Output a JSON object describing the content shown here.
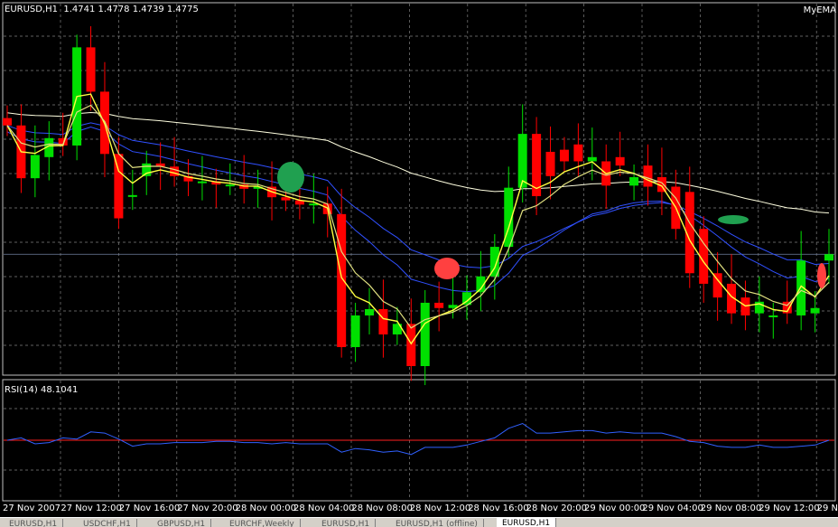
{
  "main_chart": {
    "symbol": "EURUSD,H1",
    "ohlc": "1.4741 1.4778 1.4739 1.4775",
    "indicator_name": "MyEMA",
    "time_labels": [
      "27 Nov 2007",
      "27 Nov 12:00",
      "27 Nov 16:00",
      "27 Nov 20:00",
      "28 Nov 00:00",
      "28 Nov 04:00",
      "28 Nov 08:00",
      "28 Nov 12:00",
      "28 Nov 16:00",
      "28 Nov 20:00",
      "29 Nov 00:00",
      "29 Nov 04:00",
      "29 Nov 08:00",
      "29 Nov 12:00",
      "29 Nov"
    ]
  },
  "sub_chart": {
    "indicator_label": "RSI(14) 48.1041"
  },
  "tabs": [
    {
      "label": "EURUSD,H1",
      "active": false
    },
    {
      "label": "USDCHF,H1",
      "active": false
    },
    {
      "label": "GBPUSD,H1",
      "active": false
    },
    {
      "label": "EURCHF,Weekly",
      "active": false
    },
    {
      "label": "EURUSD,H1",
      "active": false
    },
    {
      "label": "EURUSD,H1 (offline)",
      "active": false
    },
    {
      "label": "EURUSD,H1",
      "active": true
    }
  ],
  "colors": {
    "bull": "#00e000",
    "bear": "#ff0000",
    "ema_fast": "#ffff40",
    "ema_slow": "#e0e080",
    "ema_blue": "#3050ff",
    "ema_white": "#ffffe0",
    "rsi": "#3060ff",
    "rsi_level": "#ff2020",
    "grid": "#808080"
  },
  "chart_data": {
    "type": "candlestick",
    "open": [
      1.4655,
      1.4648,
      1.4598,
      1.4618,
      1.4636,
      1.4629,
      1.4722,
      1.468,
      1.4621,
      1.4582,
      1.46,
      1.4612,
      1.4609,
      1.46,
      1.4595,
      1.4595,
      1.4592,
      1.4592,
      1.4588,
      1.459,
      1.458,
      1.4577,
      1.4573,
      1.4574,
      1.4564,
      1.4438,
      1.4468,
      1.4474,
      1.445,
      1.446,
      1.442,
      1.448,
      1.4475,
      1.4478,
      1.449,
      1.4505,
      1.4533,
      1.4589,
      1.464,
      1.4623,
      1.4625,
      1.463,
      1.4614,
      1.4614,
      1.4618,
      1.4591,
      1.461,
      1.4599,
      1.459,
      1.4585,
      1.455,
      1.4508,
      1.4498,
      1.4485,
      1.447,
      1.4468,
      1.4481,
      1.4468,
      1.447,
      1.452
    ],
    "close": [
      1.4648,
      1.4598,
      1.462,
      1.4636,
      1.4629,
      1.4722,
      1.468,
      1.4621,
      1.456,
      1.4582,
      1.4612,
      1.4609,
      1.46,
      1.4595,
      1.4595,
      1.4592,
      1.4592,
      1.4588,
      1.459,
      1.458,
      1.4577,
      1.4573,
      1.4574,
      1.4564,
      1.4438,
      1.4468,
      1.4474,
      1.445,
      1.446,
      1.442,
      1.448,
      1.4475,
      1.4478,
      1.449,
      1.4505,
      1.4533,
      1.4589,
      1.464,
      1.4581,
      1.46,
      1.4614,
      1.4614,
      1.4618,
      1.4591,
      1.461,
      1.4599,
      1.459,
      1.4585,
      1.455,
      1.4508,
      1.4498,
      1.4485,
      1.447,
      1.4468,
      1.4481,
      1.4468,
      1.447,
      1.452,
      1.4475,
      1.4526
    ],
    "xlabel": "",
    "ylabel": ""
  },
  "rsi_data": [
    50,
    52,
    47,
    48,
    52,
    51,
    57,
    56,
    51,
    45,
    47,
    47,
    48,
    48,
    48,
    49,
    49,
    48,
    48,
    47,
    48,
    47,
    47,
    47,
    40,
    43,
    42,
    40,
    41,
    38,
    44,
    44,
    44,
    46,
    49,
    52,
    60,
    64,
    56,
    56,
    57,
    58,
    58,
    56,
    57,
    56,
    56,
    56,
    53,
    49,
    48,
    45,
    44,
    44,
    46,
    44,
    44,
    45,
    46,
    50
  ]
}
